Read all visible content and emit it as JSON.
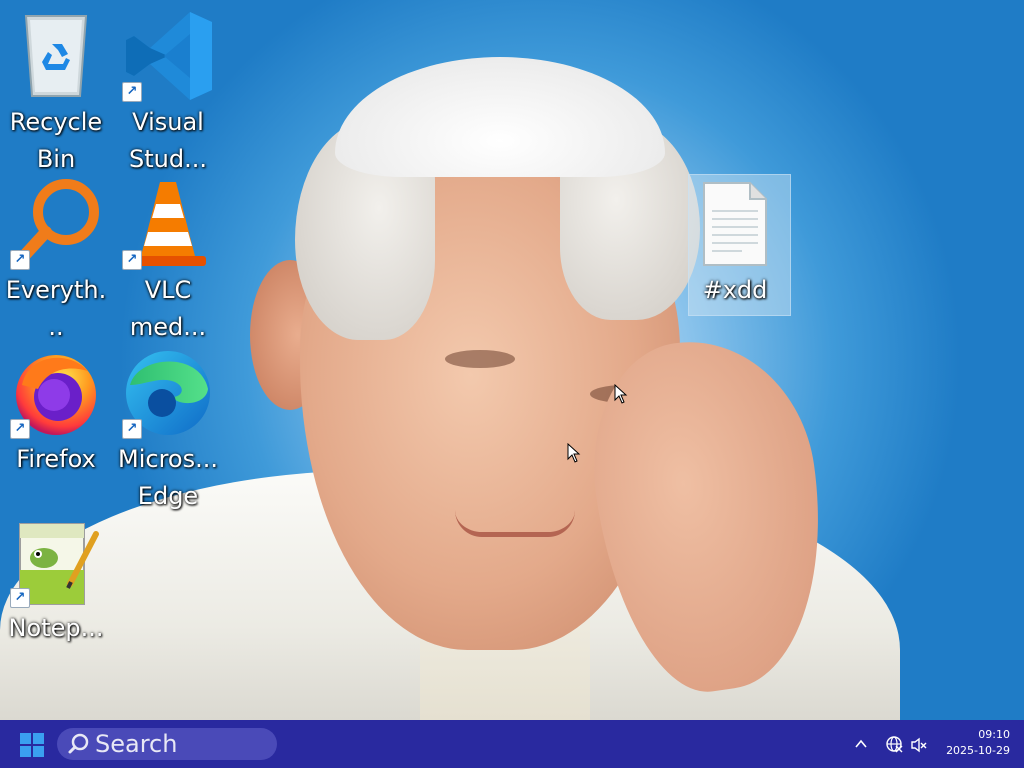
{
  "desktop": {
    "icons": [
      {
        "label": "Recycle Bin",
        "line1": "Recycle",
        "line2": "Bin",
        "icon": "recycle-bin-icon"
      },
      {
        "label": "Visual Stud...",
        "line1": "Visual",
        "line2": "Stud...",
        "icon": "vscode-icon"
      },
      {
        "label": "Everyth...",
        "line1": "Everyth...",
        "line2": "",
        "icon": "everything-search-icon"
      },
      {
        "label": "VLC med...",
        "line1": "VLC",
        "line2": "med...",
        "icon": "vlc-icon"
      },
      {
        "label": "Firefox",
        "line1": "Firefox",
        "line2": "",
        "icon": "firefox-icon"
      },
      {
        "label": "Micros... Edge",
        "line1": "Micros...",
        "line2": "Edge",
        "icon": "edge-icon"
      },
      {
        "label": "Notep...",
        "line1": "Notep...",
        "line2": "",
        "icon": "notepad-plus-plus-icon"
      },
      {
        "label": "#xdd",
        "line1": "#xdd",
        "line2": "",
        "icon": "text-file-icon"
      }
    ],
    "shortcut_arrow": "↗"
  },
  "taskbar": {
    "search_placeholder": "Search",
    "clock": {
      "time": "09:10",
      "date": "2025-10-29"
    },
    "tray_icons": [
      "chevron-up-icon",
      "network-icon",
      "volume-muted-icon"
    ],
    "color": "#29299f"
  }
}
